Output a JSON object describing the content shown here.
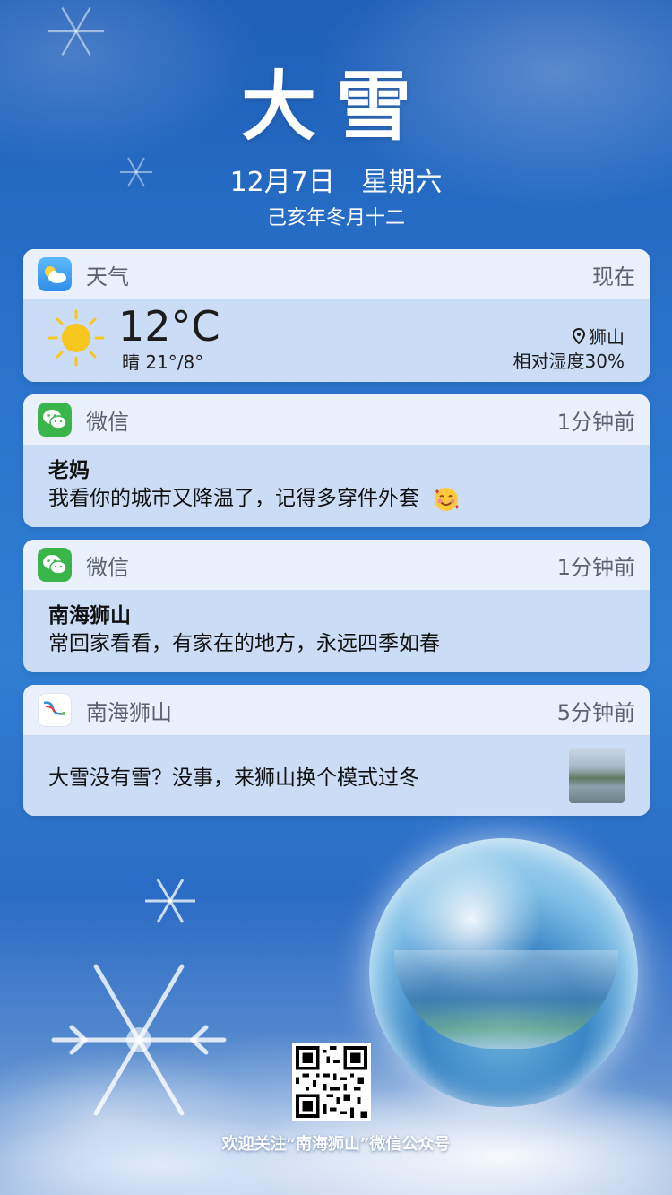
{
  "header": {
    "title": "大雪",
    "date": "12月7日",
    "weekday": "星期六",
    "lunar": "己亥年冬月十二"
  },
  "weather_card": {
    "app_name": "天气",
    "time": "现在",
    "temperature": "12°C",
    "condition": "晴 21°/8°",
    "location": "狮山",
    "humidity": "相对湿度30%",
    "icon": "sun-icon"
  },
  "notifications": [
    {
      "app_name": "微信",
      "time": "1分钟前",
      "sender": "老妈",
      "text": "我看你的城市又降温了，记得多穿件外套",
      "icon": "wechat-icon"
    },
    {
      "app_name": "微信",
      "time": "1分钟前",
      "sender": "南海狮山",
      "text": "常回家看看，有家在的地方，永远四季如春",
      "icon": "wechat-icon"
    }
  ],
  "news_card": {
    "app_name": "南海狮山",
    "time": "5分钟前",
    "text": "大雪没有雪？没事，来狮山换个模式过冬"
  },
  "footer": {
    "text": "欢迎关注“南海狮山”微信公众号"
  },
  "colors": {
    "background": "#2a73cc",
    "wechat_green": "#39b54a",
    "weather_icon_blue": "#4aa3f0",
    "sun_yellow": "#f7c71f"
  }
}
